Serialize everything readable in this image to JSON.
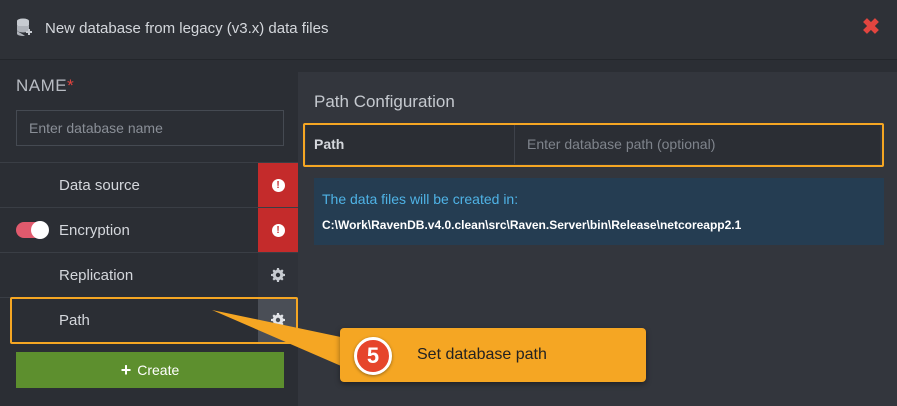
{
  "dialog": {
    "title": "New database from legacy (v3.x) data files",
    "close_label": "✖"
  },
  "name_field": {
    "label": "NAME",
    "required_mark": "*",
    "placeholder": "Enter database name",
    "value": ""
  },
  "menu": {
    "items": [
      {
        "label": "Data source",
        "status": "error"
      },
      {
        "label": "Encryption",
        "status": "error",
        "toggle_on": true
      },
      {
        "label": "Replication",
        "status": "settings"
      },
      {
        "label": "Path",
        "status": "settings-active"
      }
    ]
  },
  "create_button": {
    "icon": "+",
    "label": "Create"
  },
  "path_config": {
    "section_title": "Path Configuration",
    "path_label": "Path",
    "path_placeholder": "Enter database path (optional)",
    "path_value": "",
    "info_title": "The data files will be created in:",
    "info_path": "C:\\Work\\RavenDB.v4.0.clean\\src\\Raven.Server\\bin\\Release\\netcoreapp2.1"
  },
  "callout": {
    "step_number": "5",
    "text": "Set database path"
  },
  "colors": {
    "highlight": "#f5a623",
    "error": "#c42b2b",
    "accent_green": "#5d8f2e",
    "info_blue": "#4fb3e6",
    "toggle_on": "#e05a6d"
  }
}
